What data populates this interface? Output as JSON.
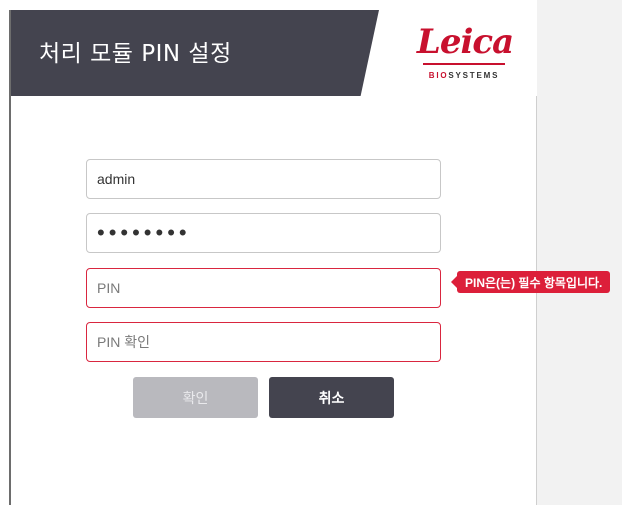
{
  "dialog": {
    "title": "처리 모듈 PIN 설정",
    "logo": {
      "word": "Leica",
      "sub_prefix": "BIO",
      "sub_rest": "SYSTEMS"
    }
  },
  "form": {
    "username": {
      "value": "admin"
    },
    "password": {
      "masked_value": "••••••••"
    },
    "pin": {
      "placeholder": "PIN",
      "error": "PIN은(는) 필수 항목입니다."
    },
    "pin_confirm": {
      "placeholder": "PIN 확인"
    }
  },
  "buttons": {
    "ok_label": "확인",
    "cancel_label": "취소"
  },
  "colors": {
    "header_dark": "#44444f",
    "error_red": "#dc1f3a",
    "brand_red": "#c8102e"
  }
}
